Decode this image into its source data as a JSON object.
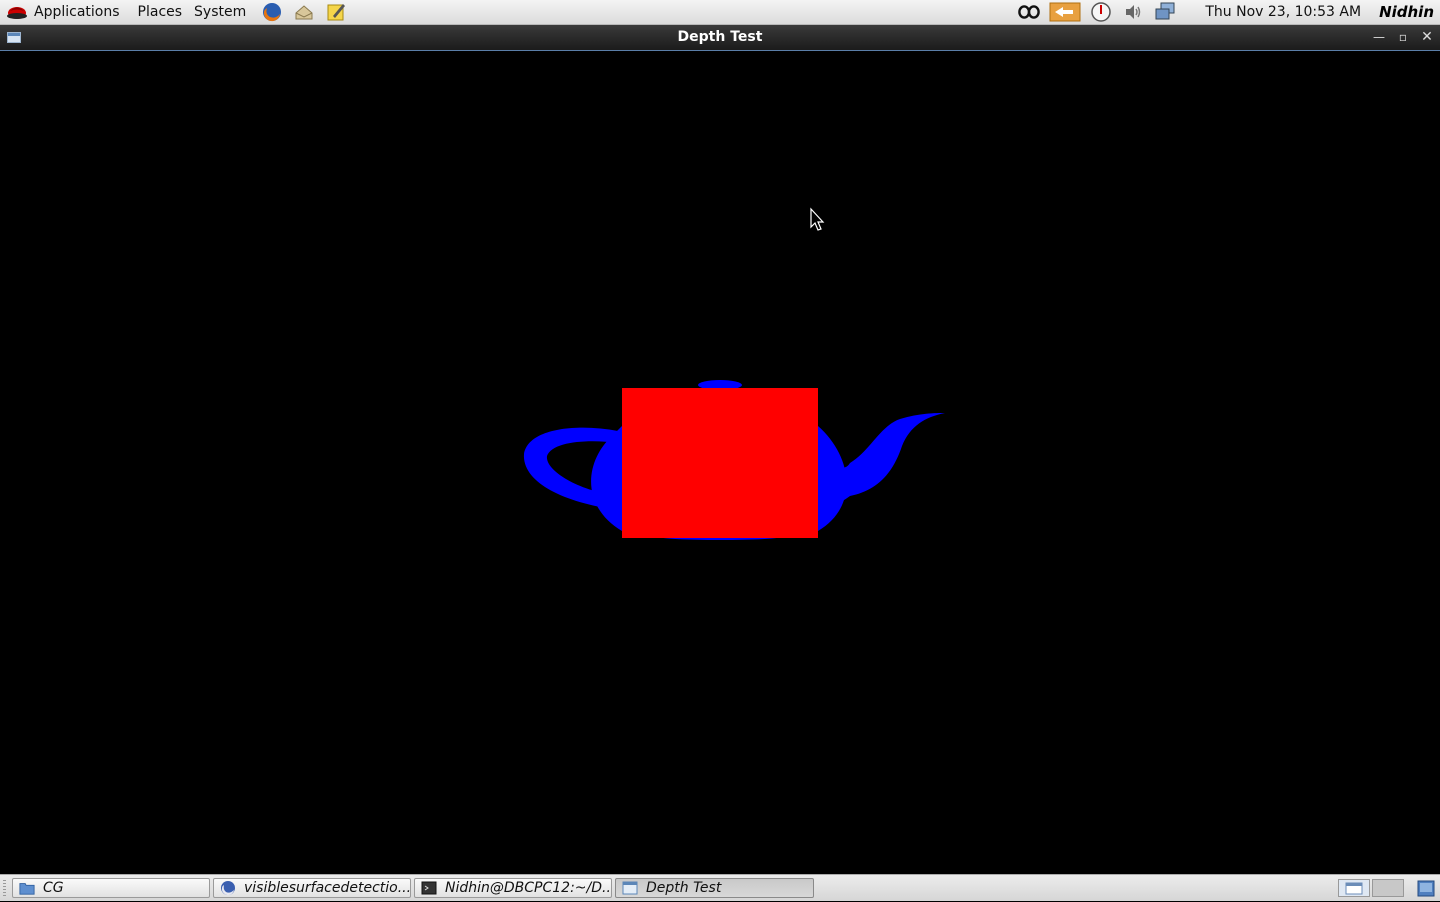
{
  "top_panel": {
    "menus": [
      "Applications",
      "Places",
      "System"
    ],
    "launchers": [
      "firefox-icon",
      "mail-icon",
      "notes-icon"
    ],
    "tray_icons": [
      "accessibility-icon",
      "updates-icon",
      "power-icon",
      "volume-icon",
      "network-icon"
    ],
    "clock": "Thu Nov 23, 10:53 AM",
    "user": "Nidhin"
  },
  "window": {
    "title": "Depth Test",
    "buttons": [
      "minimize-icon",
      "maximize-icon",
      "close-icon"
    ]
  },
  "scene": {
    "background": "#000000",
    "teapot_color": "#0000ff",
    "square_color": "#ff0000"
  },
  "taskbar": {
    "tasks": [
      {
        "label": "CG",
        "icon": "folder-icon"
      },
      {
        "label": "visiblesurfacedetectio...",
        "icon": "firefox-icon"
      },
      {
        "label": "Nidhin@DBCPC12:~/D...",
        "icon": "terminal-icon"
      },
      {
        "label": "Depth Test",
        "icon": "window-icon",
        "active": true
      }
    ]
  }
}
